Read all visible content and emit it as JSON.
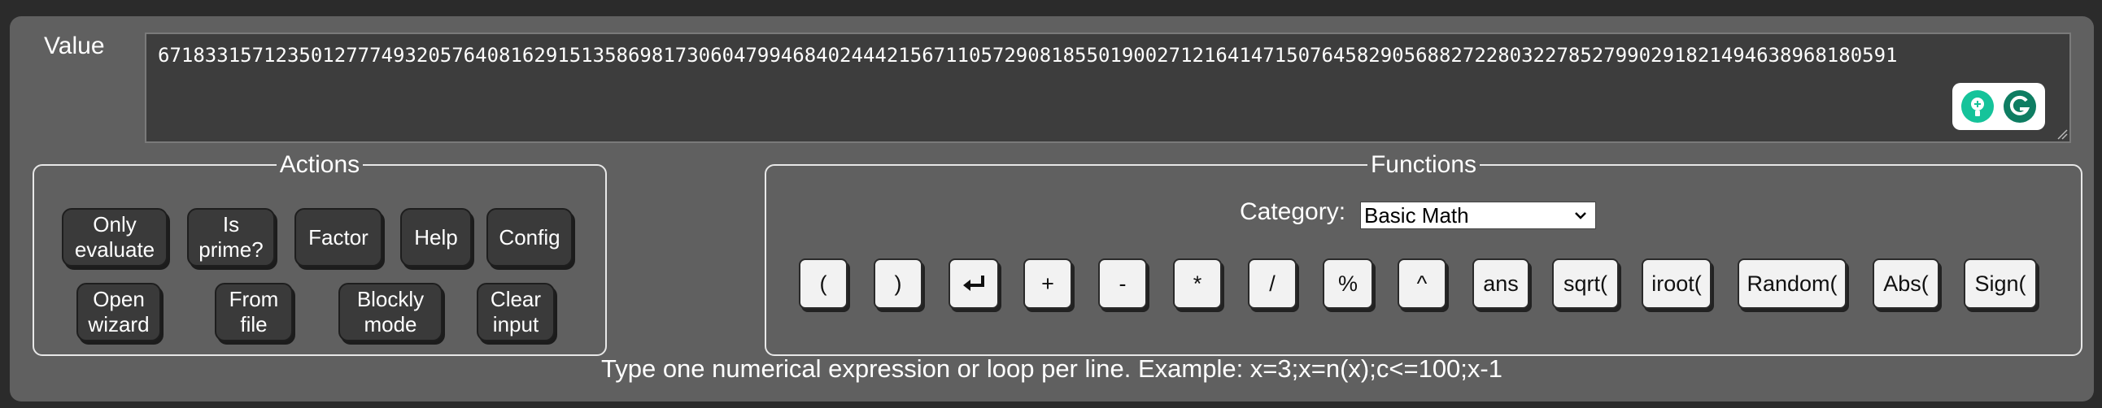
{
  "value": {
    "label": "Value",
    "text": "6718331571235012777493205764081629151358698173060479946840244421567110572908185501900271216414715076458290568827228032278527990291821494638968180591"
  },
  "actions": {
    "legend": "Actions",
    "buttons": {
      "only_evaluate": "Only\nevaluate",
      "is_prime": "Is\nprime?",
      "factor": "Factor",
      "help": "Help",
      "config": "Config",
      "open_wizard": "Open\nwizard",
      "from_file": "From\nfile",
      "blockly_mode": "Blockly\nmode",
      "clear_input": "Clear\ninput"
    }
  },
  "functions": {
    "legend": "Functions",
    "category_label": "Category:",
    "category_selected": "Basic Math",
    "buttons": {
      "open_paren": "(",
      "close_paren": ")",
      "enter": "↵",
      "plus": "+",
      "minus": "-",
      "times": "*",
      "divide": "/",
      "percent": "%",
      "power": "^",
      "ans": "ans",
      "sqrt": "sqrt(",
      "iroot": "iroot(",
      "random": "Random(",
      "abs": "Abs(",
      "sign": "Sign("
    }
  },
  "hint": "Type one numerical expression or loop per line. Example: x=3;x=n(x);c<=100;x-1",
  "colors": {
    "panel_bg": "#606060",
    "input_bg": "#3d3d3d",
    "dark_button": "#3a3a3a",
    "light_button": "#f2f2f2",
    "grammarly_green": "#15c39a",
    "grammarly_dark": "#0e7d62"
  }
}
